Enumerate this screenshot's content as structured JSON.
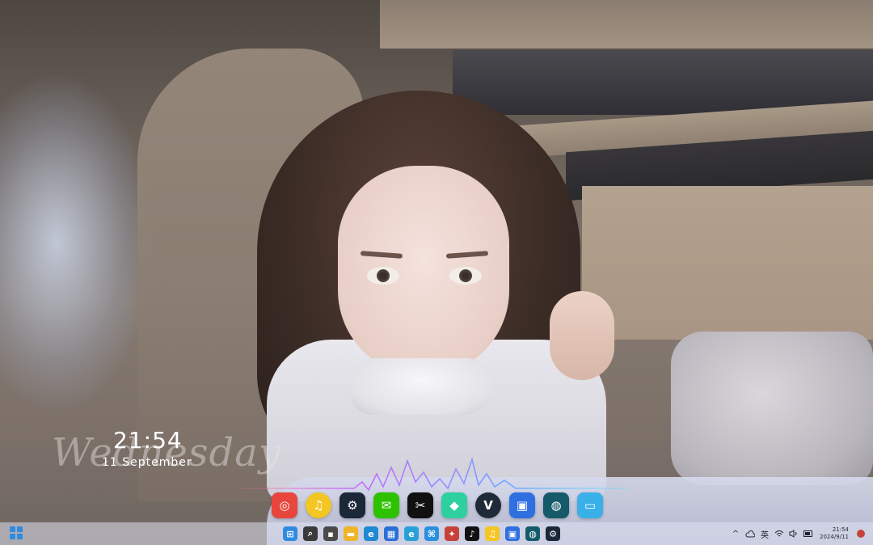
{
  "clock_widget": {
    "weekday": "Wednesday",
    "time": "21:54",
    "date": "11 September"
  },
  "dock": {
    "apps": [
      {
        "name": "netease-music",
        "color": "#e8453c",
        "glyph": "◎"
      },
      {
        "name": "qq-music",
        "color": "#f3c623",
        "glyph": "♫"
      },
      {
        "name": "steam",
        "color": "#1b2838",
        "glyph": "⚙"
      },
      {
        "name": "wechat",
        "color": "#2dc100",
        "glyph": "✉"
      },
      {
        "name": "capcut",
        "color": "#111111",
        "glyph": "✂"
      },
      {
        "name": "wps",
        "color": "#2fd0a0",
        "glyph": "◆"
      },
      {
        "name": "vivaldi",
        "color": "#1e2a38",
        "glyph": "V"
      },
      {
        "name": "screenshot-tool",
        "color": "#2f6fe0",
        "glyph": "▣"
      },
      {
        "name": "xbox-app",
        "color": "#155a6a",
        "glyph": "◍"
      },
      {
        "name": "desktop",
        "color": "#3ab0e8",
        "glyph": "▭"
      }
    ]
  },
  "taskbar": {
    "apps": [
      {
        "name": "start",
        "color": "#2f8be0",
        "glyph": "⊞"
      },
      {
        "name": "search",
        "color": "#3a3a3a",
        "glyph": "⌕"
      },
      {
        "name": "task-view",
        "color": "#4a4a4a",
        "glyph": "▪"
      },
      {
        "name": "file-explorer",
        "color": "#f0b429",
        "glyph": "▬"
      },
      {
        "name": "edge",
        "color": "#1f8ad4",
        "glyph": "e"
      },
      {
        "name": "microsoft-store",
        "color": "#2b6fd6",
        "glyph": "▦"
      },
      {
        "name": "edge-beta",
        "color": "#2aa0d8",
        "glyph": "e"
      },
      {
        "name": "visual-studio-code",
        "color": "#2b8fe0",
        "glyph": "⌘"
      },
      {
        "name": "anki",
        "color": "#c7413b",
        "glyph": "✦"
      },
      {
        "name": "tiktok",
        "color": "#111111",
        "glyph": "♪"
      },
      {
        "name": "qq-music",
        "color": "#f3c623",
        "glyph": "♫"
      },
      {
        "name": "screenshot-tool",
        "color": "#2f6fe0",
        "glyph": "▣"
      },
      {
        "name": "xbox-app",
        "color": "#155a6a",
        "glyph": "◍"
      },
      {
        "name": "steam",
        "color": "#1b2838",
        "glyph": "⚙"
      }
    ],
    "tray": {
      "overflow": "^",
      "ime": "英",
      "time": "21:54",
      "date": "2024/9/11"
    }
  }
}
